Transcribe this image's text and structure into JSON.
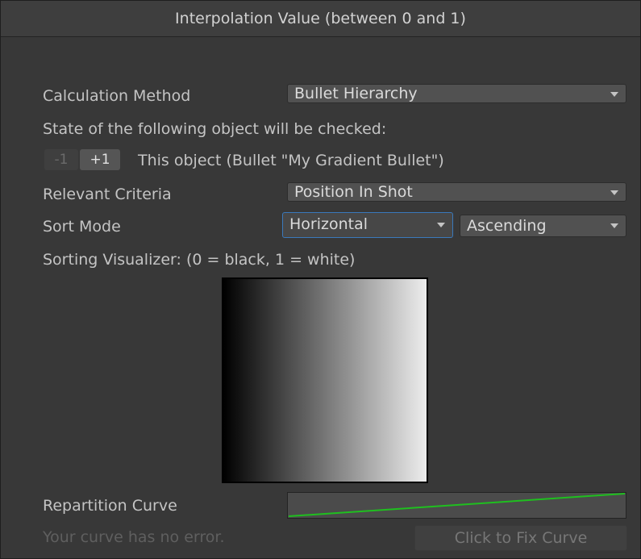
{
  "header": {
    "title": "Interpolation Value (between 0 and 1)"
  },
  "calculation_method": {
    "label": "Calculation Method",
    "value": "Bullet Hierarchy"
  },
  "state_info": {
    "text": "State of the following object will be checked:",
    "minus_label": "-1",
    "plus_label": "+1",
    "object_text": "This object (Bullet \"My Gradient Bullet\")"
  },
  "relevant_criteria": {
    "label": "Relevant Criteria",
    "value": "Position In Shot"
  },
  "sort_mode": {
    "label": "Sort Mode",
    "direction": "Horizontal",
    "order": "Ascending"
  },
  "visualizer": {
    "label": "Sorting Visualizer: (0 = black, 1 = white)",
    "gradient_from": "#000000",
    "gradient_to": "#ededed"
  },
  "repartition_curve": {
    "label": "Repartition Curve",
    "curve_color": "#1fbf1f"
  },
  "curve_status": {
    "text": "Your curve has no error.",
    "fix_button": "Click to Fix Curve"
  },
  "colors": {
    "focus_border": "#3a79bb",
    "panel_bg": "#383838"
  }
}
